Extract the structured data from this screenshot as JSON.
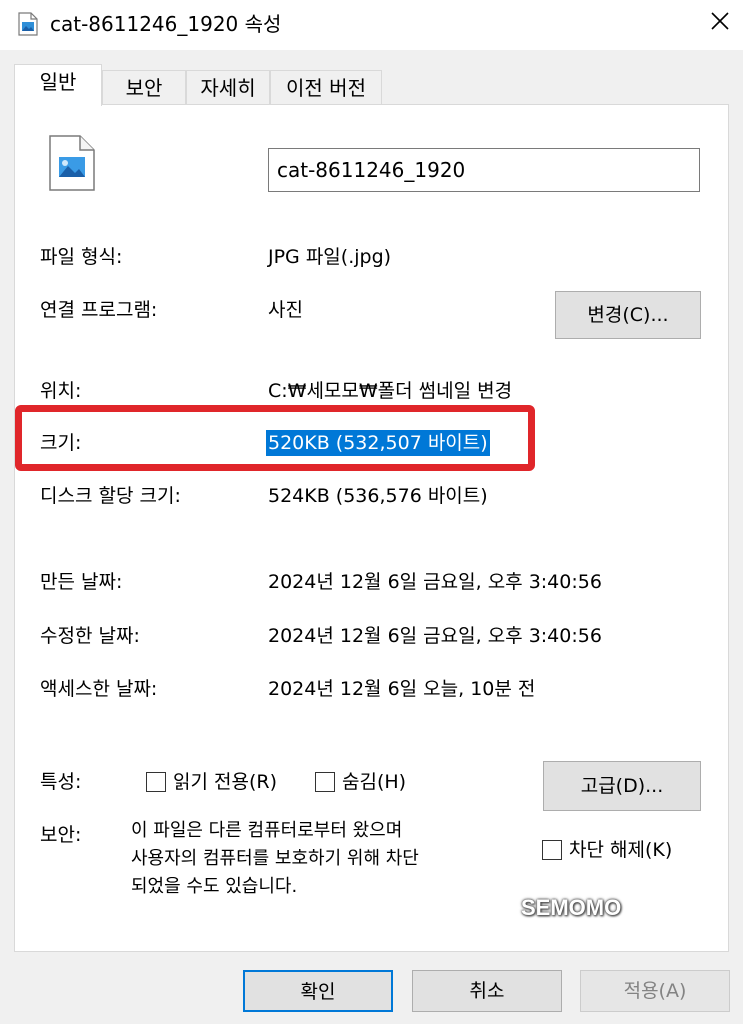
{
  "window": {
    "title": "cat-8611246_1920 속성",
    "close_symbol": "✕"
  },
  "tabs": [
    {
      "label": "일반",
      "active": true
    },
    {
      "label": "보안",
      "active": false
    },
    {
      "label": "자세히",
      "active": false
    },
    {
      "label": "이전 버전",
      "active": false
    }
  ],
  "general": {
    "file_name": "cat-8611246_1920",
    "file_type_label": "파일 형식:",
    "file_type_value": "JPG 파일(.jpg)",
    "opens_with_label": "연결 프로그램:",
    "opens_with_value": "사진",
    "change_button": "변경(C)...",
    "location_label": "위치:",
    "location_value": "C:₩세모모₩폴더 썸네일 변경",
    "size_label": "크기:",
    "size_value": "520KB (532,507 바이트)",
    "size_on_disk_label": "디스크 할당 크기:",
    "size_on_disk_value": "524KB (536,576 바이트)",
    "created_label": "만든 날짜:",
    "created_value": "2024년 12월 6일 금요일, 오후 3:40:56",
    "modified_label": "수정한 날짜:",
    "modified_value": "2024년 12월 6일 금요일, 오후 3:40:56",
    "accessed_label": "액세스한 날짜:",
    "accessed_value": "2024년 12월 6일 오늘, 10분 전",
    "attributes_label": "특성:",
    "readonly_label": "읽기 전용(R)",
    "hidden_label": "숨김(H)",
    "advanced_button": "고급(D)...",
    "security_label": "보안:",
    "security_note": "이 파일은 다른 컴퓨터로부터 왔으며\n사용자의 컴퓨터를 보호하기 위해 차단\n되었을 수도 있습니다.",
    "unblock_label": "차단 해제(K)"
  },
  "watermark": "SEMOMO",
  "footer": {
    "ok_button": "확인",
    "cancel_button": "취소",
    "apply_button": "적용(A)"
  },
  "colors": {
    "accent": "#0078d7",
    "highlight_border": "#e0262a"
  },
  "icons": {
    "title": "image-file-icon",
    "file": "image-file-icon",
    "close": "close-icon"
  }
}
